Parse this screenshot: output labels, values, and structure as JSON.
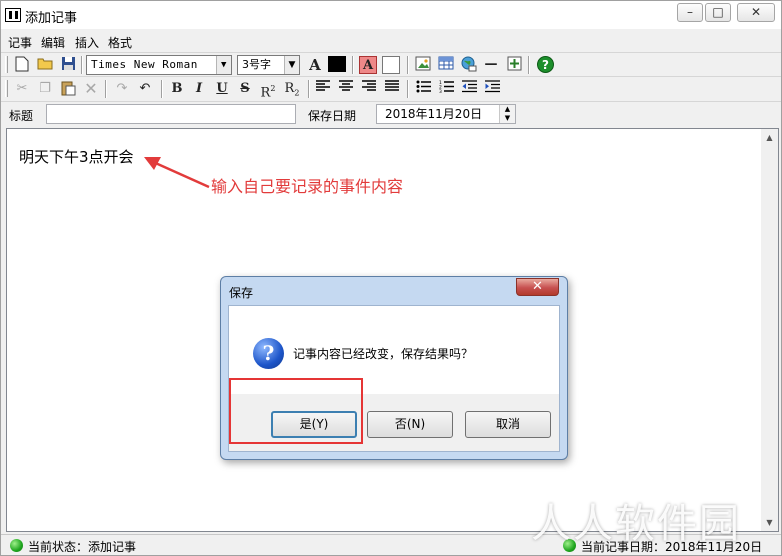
{
  "window": {
    "title": "添加记事"
  },
  "menu": [
    "记事",
    "编辑",
    "插入",
    "格式"
  ],
  "toolbar": {
    "font_name": "Times New Roman",
    "font_size": "3号字"
  },
  "form": {
    "title_label": "标题",
    "title_value": "",
    "date_label": "保存日期",
    "date_value": "2018年11月20日"
  },
  "editor": {
    "content": "明天下午3点开会"
  },
  "annotation": "输入自己要记录的事件内容",
  "dialog": {
    "title": "保存",
    "message": "记事内容已经改变，保存结果吗？",
    "buttons": {
      "yes": "是(Y)",
      "no": "否(N)",
      "cancel": "取消"
    }
  },
  "status": {
    "left": "当前状态：添加记事",
    "right": "当前记事日期：2018年11月20日"
  },
  "watermark": "人人软件园",
  "colors": {
    "annotation": "#e23b3b",
    "highlight_box": "#e53535",
    "dialog_frame": "#c5d9f1"
  }
}
